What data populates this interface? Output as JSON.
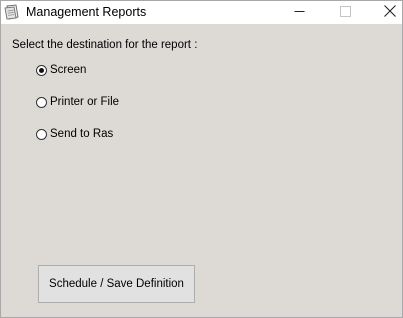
{
  "window": {
    "title": "Management Reports",
    "icon": "report-document-icon"
  },
  "caption_buttons": {
    "minimize_icon": "minimize-icon",
    "maximize_icon": "maximize-icon",
    "close_icon": "close-icon"
  },
  "form": {
    "prompt": "Select the destination for the report :",
    "options": [
      {
        "label": "Screen",
        "checked": true
      },
      {
        "label": "Printer or File",
        "checked": false
      },
      {
        "label": "Send to Ras",
        "checked": false
      }
    ],
    "action_label": "Schedule / Save Definition"
  },
  "colors": {
    "client_background": "#ddd9d5",
    "titlebar_background": "#ffffff",
    "button_face": "#e1e1e1"
  }
}
